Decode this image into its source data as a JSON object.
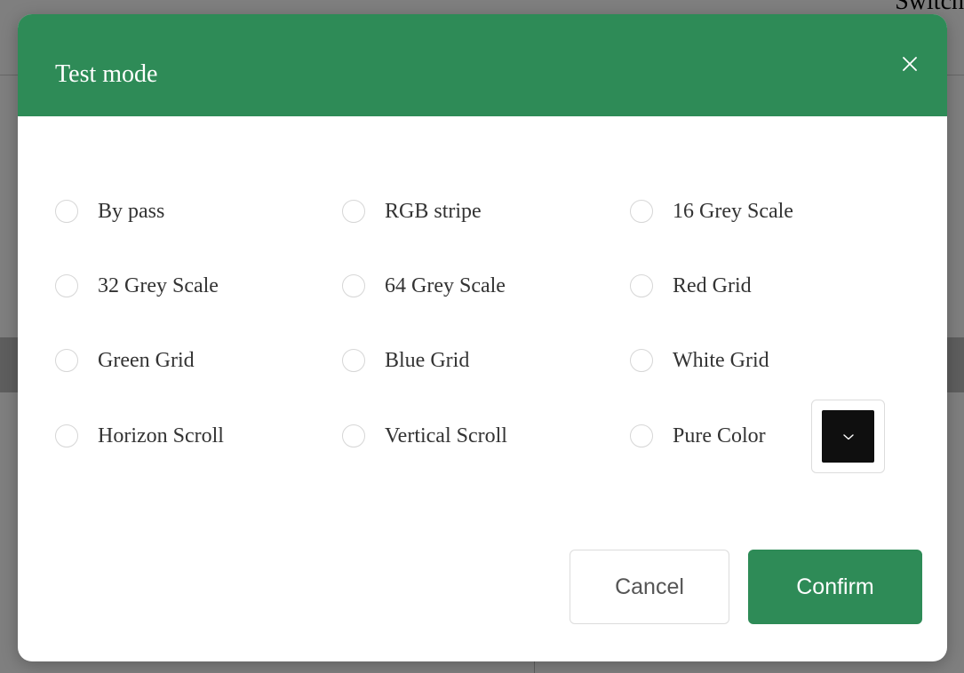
{
  "background": {
    "partial_text": "Switch"
  },
  "modal": {
    "title": "Test mode",
    "close_icon": "close-icon",
    "header_color": "#2e8b57",
    "options": [
      {
        "label": "By pass",
        "selected": false
      },
      {
        "label": "RGB stripe",
        "selected": false
      },
      {
        "label": "16 Grey Scale",
        "selected": false
      },
      {
        "label": "32 Grey Scale",
        "selected": false
      },
      {
        "label": "64 Grey Scale",
        "selected": false
      },
      {
        "label": "Red Grid",
        "selected": false
      },
      {
        "label": "Green Grid",
        "selected": false
      },
      {
        "label": "Blue Grid",
        "selected": false
      },
      {
        "label": "White Grid",
        "selected": false
      },
      {
        "label": "Horizon Scroll",
        "selected": false
      },
      {
        "label": "Vertical Scroll",
        "selected": false
      },
      {
        "label": "Pure Color",
        "selected": false
      }
    ],
    "color_picker": {
      "value": "#0f0f0f",
      "icon": "chevron-down-icon"
    },
    "buttons": {
      "cancel_label": "Cancel",
      "confirm_label": "Confirm"
    }
  }
}
